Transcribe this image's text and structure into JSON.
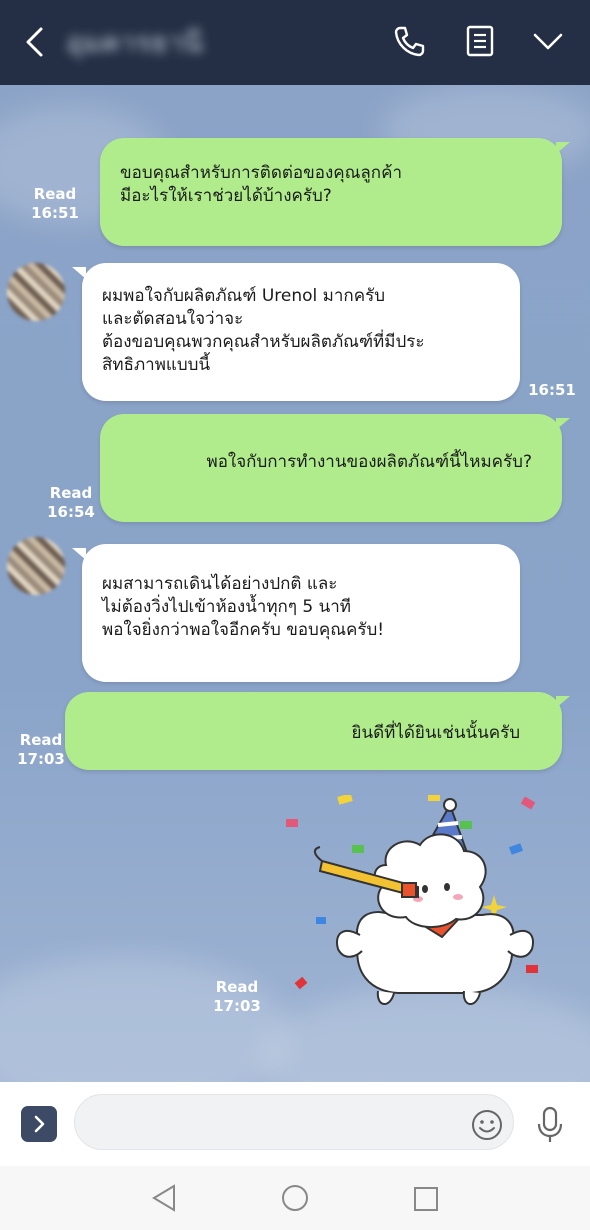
{
  "header": {
    "contact_name": "อุมคารธานี",
    "back_icon": "chevron-left-icon",
    "call_icon": "phone-icon",
    "notes_icon": "notes-icon",
    "menu_icon": "chevron-down-icon"
  },
  "messages": [
    {
      "side": "sent",
      "lines": [
        "ขอบคุณสำหรับการติดต่อของคุณลูกค้า",
        "มีอะไรให้เราช่วยได้บ้างครับ?"
      ],
      "status": "Read",
      "time": "16:51"
    },
    {
      "side": "received",
      "lines": [
        "ผมพอใจกับผลิตภัณฑ์ Urenol มากครับ",
        "และตัดสอนใจว่าจะ",
        "ต้องขอบคุณพวกคุณสำหรับผลิตภัณฑ์ที่มีประ",
        "สิทธิภาพแบบนี้"
      ],
      "time": "16:51"
    },
    {
      "side": "sent",
      "lines": [
        "พอใจกับการทำงานของผลิตภัณฑ์นี้ไหมครับ?"
      ],
      "status": "Read",
      "time": "16:54"
    },
    {
      "side": "received",
      "lines": [
        "ผมสามารถเดินได้อย่างปกติ และ",
        "ไม่ต้องวิ่งไปเข้าห้องน้ำทุกๆ 5 นาที",
        "พอใจยิ่งกว่าพอใจอีกครับ ขอบคุณครับ!"
      ],
      "time": ""
    },
    {
      "side": "sent",
      "lines": [
        "ยินดีที่ได้ยินเช่นนั้นครับ"
      ],
      "status": "Read",
      "time": "17:03"
    }
  ],
  "sticker": {
    "name": "party-sheep-sticker",
    "status": "Read",
    "time": "17:03"
  },
  "composer": {
    "placeholder": "",
    "expand_icon": "chevron-right-icon",
    "emoji_icon": "smiley-icon",
    "mic_icon": "microphone-icon"
  },
  "navbar": {
    "back": "nav-back-icon",
    "home": "nav-home-icon",
    "recents": "nav-recents-icon"
  },
  "colors": {
    "header_bg": "#242f45",
    "sent_bubble": "#b0ec8b",
    "received_bubble": "#ffffff",
    "chat_bg": "#8aa3c8"
  }
}
